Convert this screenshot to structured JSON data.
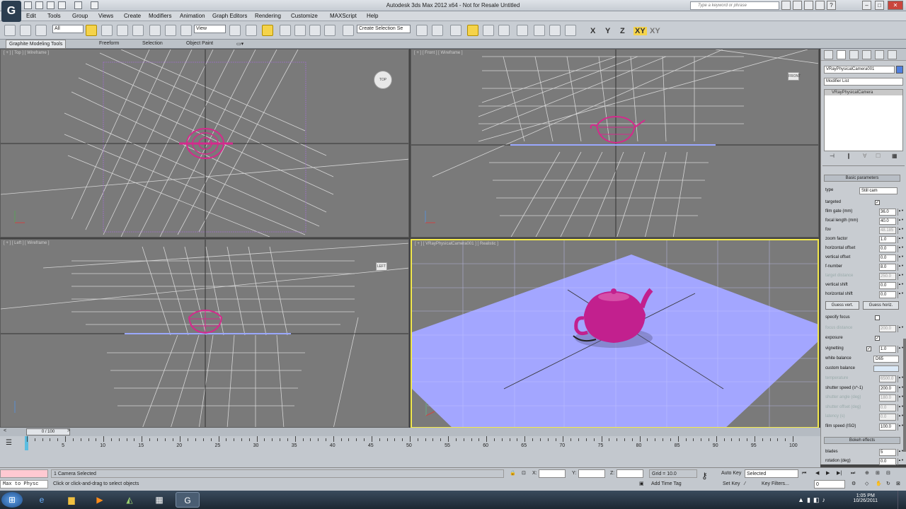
{
  "window": {
    "title": "Autodesk 3ds Max  2012 x64    -  Not for Resale   Untitled",
    "search_placeholder": "Type a keyword or phrase",
    "app_icon": "3ds-max-logo"
  },
  "menu": [
    "Edit",
    "Tools",
    "Group",
    "Views",
    "Create",
    "Modifiers",
    "Animation",
    "Graph Editors",
    "Rendering",
    "Customize",
    "MAXScript",
    "Help"
  ],
  "toolbar": {
    "filter": "All",
    "coord_system": "View",
    "named_selection": "Create Selection Se",
    "axes": [
      "X",
      "Y",
      "Z",
      "XY",
      "XY"
    ]
  },
  "ribbon": {
    "tabs": [
      "Graphite Modeling Tools",
      "Freeform",
      "Selection",
      "Object Paint"
    ]
  },
  "viewports": {
    "top": {
      "label": "[ + ] [ Top ] [ Wireframe ]",
      "cube": "TOP"
    },
    "front": {
      "label": "[ + ] [ Front ] [ Wireframe ]",
      "cube": "FRONT"
    },
    "left": {
      "label": "[ + ] [ Left ] [ Wireframe ]",
      "cube": "LEFT"
    },
    "camera": {
      "label": "[ + ] [ VRayPhysicalCamera001 ] [ Realistic ]"
    }
  },
  "command_panel": {
    "object_name": "VRayPhysicalCamera001",
    "modifier_list": "Modifier List",
    "stack_item": "VRayPhysicalCamera",
    "basic_rollout": "Basic parameters",
    "type_label": "type",
    "type_value": "Still cam",
    "params": [
      {
        "label": "targeted",
        "check": true
      },
      {
        "label": "film gate (mm)",
        "value": "36.0"
      },
      {
        "label": "focal length (mm)",
        "value": "40.0"
      },
      {
        "label": "fov",
        "value": "48.185",
        "dim_value": true
      },
      {
        "label": "zoom factor",
        "value": "1.0"
      },
      {
        "label": "horizontal offset",
        "value": "0.0"
      },
      {
        "label": "vertical offset",
        "value": "0.0"
      },
      {
        "label": "f-number",
        "value": "8.0"
      },
      {
        "label": "target distance",
        "value": "250.0",
        "dim": true
      },
      {
        "label": "vertical shift",
        "value": "0.0"
      },
      {
        "label": "horizontal shift",
        "value": "0.0"
      }
    ],
    "guess_vert": "Guess vert.",
    "guess_horiz": "Guess horiz.",
    "params2": [
      {
        "label": "specify focus",
        "check": false
      },
      {
        "label": "focus distance",
        "value": "200.0",
        "dim": true
      },
      {
        "label": "exposure",
        "check": true
      },
      {
        "label": "vignetting",
        "check": true,
        "value": "1.0"
      }
    ],
    "white_balance_label": "white balance",
    "white_balance_value": "D65",
    "custom_balance_label": "custom balance",
    "custom_balance_color": "#dbe9f7",
    "params3": [
      {
        "label": "temperature",
        "value": "6500.0",
        "dim": true
      },
      {
        "label": "shutter speed (s^-1)",
        "value": "200.0"
      },
      {
        "label": "shutter angle (deg)",
        "value": "180.0",
        "dim": true
      },
      {
        "label": "shutter offset (deg)",
        "value": "0.0",
        "dim": true
      },
      {
        "label": "latency (s)",
        "value": "0.0",
        "dim": true
      },
      {
        "label": "film speed (ISO)",
        "value": "100.0"
      }
    ],
    "bokeh_rollout": "Bokeh effects",
    "bokeh_params": [
      {
        "label": "blades",
        "value": "5"
      },
      {
        "label": "rotation (deg)",
        "value": "0.0"
      }
    ]
  },
  "timeline": {
    "slider": "0 / 100",
    "ticks": [
      "5",
      "10",
      "15",
      "20",
      "25",
      "30",
      "35",
      "40",
      "45",
      "50",
      "55",
      "60",
      "65",
      "70",
      "75",
      "80",
      "85",
      "90",
      "95",
      "100"
    ],
    "progress": 0
  },
  "status": {
    "listener": "Max to Physc",
    "selected": "1 Camera Selected",
    "prompt": "Click or click-and-drag to select objects",
    "x_label": "X:",
    "y_label": "Y:",
    "z_label": "Z:",
    "grid": "Grid = 10.0",
    "add_time_tag": "Add Time Tag",
    "auto_key": "Auto Key",
    "set_key": "Set Key",
    "key_mode": "Selected",
    "key_filters": "Key Filters...",
    "frame": "0"
  },
  "taskbar": {
    "time": "1:05 PM",
    "date": "10/26/2011"
  },
  "colors": {
    "accent": "#f2e84c",
    "teapot": "#c2208e",
    "plane": "#a3a6ff",
    "grid_line": "#d6d6d6",
    "teapot_wire": "#d42a8c"
  }
}
